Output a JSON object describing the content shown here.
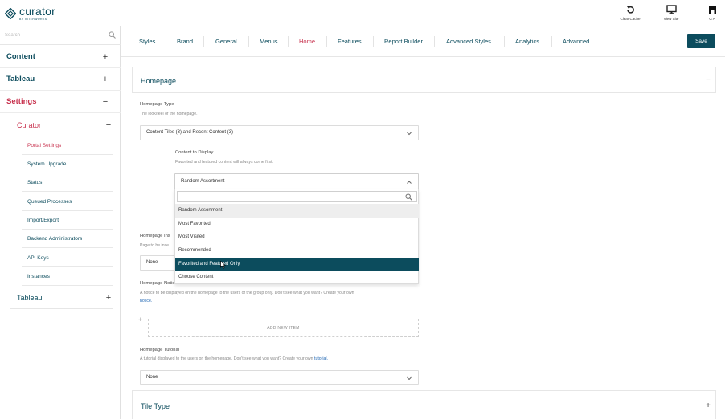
{
  "header": {
    "logo_name": "curator",
    "logo_sub": "BY INTERWORKS",
    "actions": [
      {
        "label": "Clear Cache",
        "icon": "refresh-icon"
      },
      {
        "label": "View Site",
        "icon": "monitor-icon"
      },
      {
        "label": "G A",
        "icon": "user-icon"
      }
    ]
  },
  "sidebar": {
    "search_placeholder": "Search",
    "content": {
      "label": "Content",
      "sign": "+"
    },
    "tableau": {
      "label": "Tableau",
      "sign": "+"
    },
    "settings": {
      "label": "Settings",
      "sign": "−"
    },
    "curator": {
      "label": "Curator",
      "sign": "−"
    },
    "items": [
      {
        "label": "Portal Settings"
      },
      {
        "label": "System Upgrade"
      },
      {
        "label": "Status"
      },
      {
        "label": "Queued Processes"
      },
      {
        "label": "Import/Export"
      },
      {
        "label": "Backend Administrators"
      },
      {
        "label": "API Keys"
      },
      {
        "label": "Instances"
      }
    ],
    "tableau_sub": {
      "label": "Tableau",
      "sign": "+"
    }
  },
  "tabs": [
    {
      "label": "Styles"
    },
    {
      "label": "Brand"
    },
    {
      "label": "General"
    },
    {
      "label": "Menus"
    },
    {
      "label": "Home"
    },
    {
      "label": "Features"
    },
    {
      "label": "Report Builder"
    },
    {
      "label": "Advanced Styles"
    },
    {
      "label": "Analytics"
    },
    {
      "label": "Advanced"
    }
  ],
  "active_tab": "Home",
  "save_label": "Save",
  "homepage": {
    "title": "Homepage",
    "toggle": "−",
    "type_label": "Homepage Type",
    "type_desc": "The look/feel of the homepage.",
    "type_value": "Content Tiles (3) and Recent Content (3)",
    "content_label": "Content to Display",
    "content_desc": "Favorited and featured content will always come first.",
    "content_value": "Random Assortment",
    "options": [
      {
        "label": "Random Assortment"
      },
      {
        "label": "Most Favorited"
      },
      {
        "label": "Most Visited"
      },
      {
        "label": "Recommended"
      },
      {
        "label": "Favorited and Featured Only"
      },
      {
        "label": "Choose Content"
      }
    ],
    "hovered_option": "Random Assortment",
    "selected_option": "Favorited and Featured Only",
    "inst_label": "Homepage Ins",
    "inst_desc": "Page to be inse",
    "inst_value": "None",
    "notices_label": "Homepage Notices",
    "notices_desc": "A notice to be displayed on the homepage to the users of the group only. Don't see what you want? Create your own",
    "notices_link": "notice.",
    "add_new_item": "ADD NEW ITEM",
    "add_plus": "+",
    "tutorial_label": "Homepage Tutorial",
    "tutorial_desc": "A tutorial displayed to the users on the homepage. Don't see what you want? Create your own",
    "tutorial_link": "tutorial.",
    "tutorial_value": "None"
  },
  "tile_type": {
    "title": "Tile Type",
    "toggle": "+"
  },
  "colors": {
    "brand": "#0c4c5d",
    "active": "#c8334f",
    "link": "#1f66b3"
  }
}
